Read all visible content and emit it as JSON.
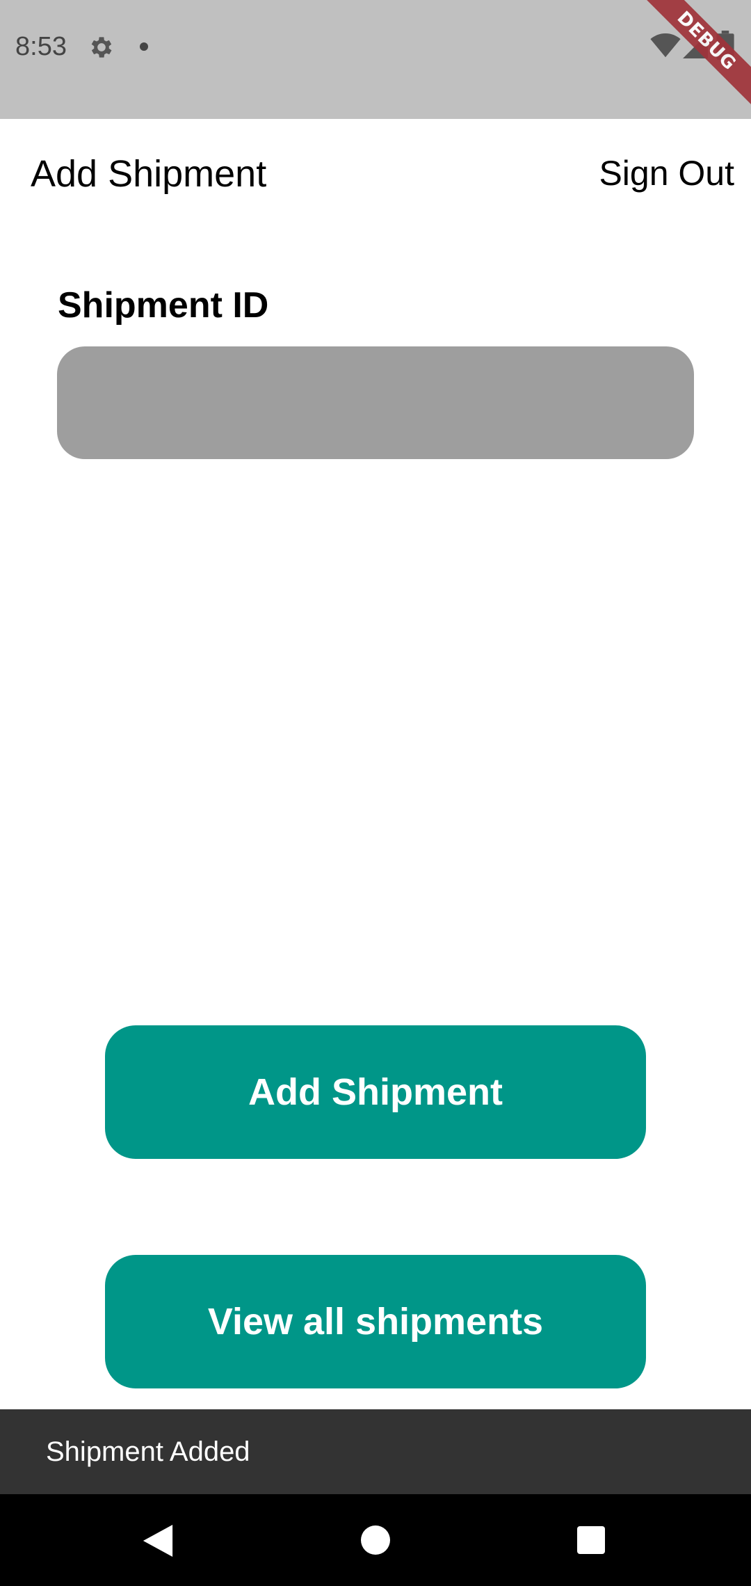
{
  "status_bar": {
    "time": "8:53",
    "debug_label": "DEBUG",
    "icons": [
      "gear-icon",
      "dot-icon",
      "wifi-icon",
      "signal-icon",
      "battery-icon"
    ]
  },
  "app_bar": {
    "title": "Add Shipment",
    "sign_out_label": "Sign Out"
  },
  "form": {
    "shipment_id_label": "Shipment ID",
    "shipment_id_value": ""
  },
  "buttons": {
    "add_shipment_label": "Add Shipment",
    "view_all_label": "View all shipments"
  },
  "snackbar": {
    "message": "Shipment Added"
  },
  "nav_bar": {
    "icons": [
      "back-icon",
      "home-icon",
      "recents-icon"
    ]
  },
  "colors": {
    "accent": "#009688",
    "status_bar": "#c0c0c0",
    "input_fill": "#9e9e9e",
    "snackbar": "#333333",
    "debug_ribbon": "#a0333a"
  }
}
